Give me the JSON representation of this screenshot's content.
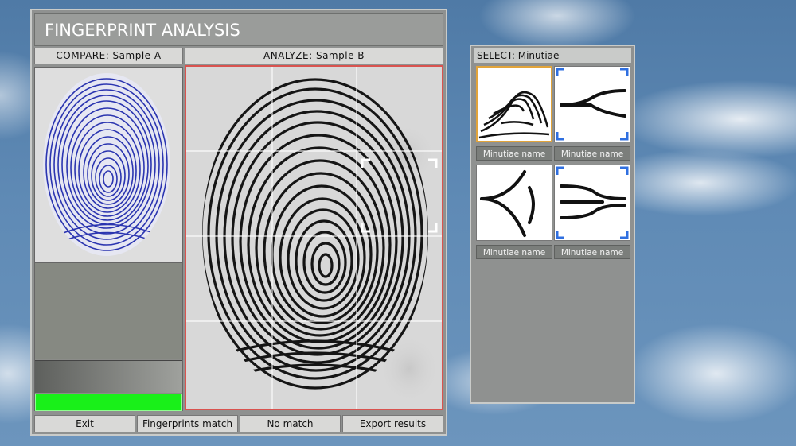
{
  "app": {
    "title": "FINGERPRINT ANALYSIS"
  },
  "compare": {
    "header": "COMPARE: Sample A",
    "progress_percent": 100,
    "colors": {
      "print": "#2b35b0",
      "progress": "#19f019"
    }
  },
  "analyze": {
    "header": "ANALYZE: Sample B",
    "colors": {
      "border": "#d9534f",
      "print": "#151515"
    }
  },
  "select": {
    "header": "SELECT: Minutiae",
    "cards": [
      {
        "label": "Minutiae name",
        "icon": "ridge-pattern-icon",
        "state": "selected"
      },
      {
        "label": "Minutiae name",
        "icon": "bifurcation-icon",
        "state": "corner-marked"
      },
      {
        "label": "Minutiae name",
        "icon": "trifurcation-icon",
        "state": "normal"
      },
      {
        "label": "Minutiae name",
        "icon": "double-bifurcation-icon",
        "state": "corner-marked"
      }
    ]
  },
  "actions": {
    "exit": "Exit",
    "match": "Fingerprints match",
    "no_match": "No match",
    "export": "Export results"
  }
}
